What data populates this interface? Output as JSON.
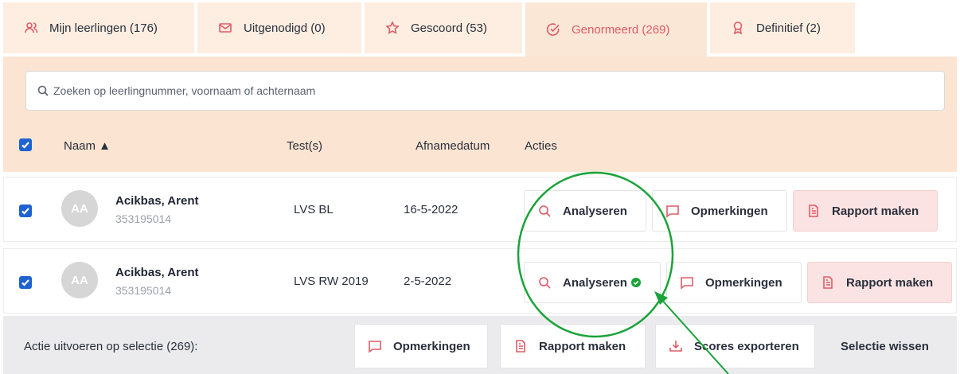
{
  "tabs": [
    {
      "label": "Mijn leerlingen (176)",
      "icon": "users-icon"
    },
    {
      "label": "Uitgenodigd (0)",
      "icon": "mail-icon"
    },
    {
      "label": "Gescoord (53)",
      "icon": "star-icon"
    },
    {
      "label": "Genormeerd (269)",
      "icon": "check-circle-icon"
    },
    {
      "label": "Definitief (2)",
      "icon": "award-icon"
    }
  ],
  "search": {
    "placeholder": "Zoeken op leerlingnummer, voornaam of achternaam"
  },
  "table": {
    "headers": {
      "name": "Naam ▲",
      "tests": "Test(s)",
      "date": "Afnamedatum",
      "actions": "Acties"
    },
    "rows": [
      {
        "initials": "AA",
        "name": "Acikbas, Arent",
        "number": "353195014",
        "test": "LVS BL",
        "date": "16-5-2022",
        "analyse": "Analyseren",
        "remarks": "Opmerkingen",
        "report": "Rapport maken",
        "analysed": false
      },
      {
        "initials": "AA",
        "name": "Acikbas, Arent",
        "number": "353195014",
        "test": "LVS RW 2019",
        "date": "2-5-2022",
        "analyse": "Analyseren",
        "remarks": "Opmerkingen",
        "report": "Rapport maken",
        "analysed": true
      }
    ]
  },
  "footer": {
    "label": "Actie uitvoeren op selectie (269):",
    "remarks": "Opmerkingen",
    "report": "Rapport maken",
    "export": "Scores exporteren",
    "clear": "Selectie wissen"
  },
  "colors": {
    "accent": "#e05b66",
    "panel": "#fbe5d2",
    "checkbox": "#1e63d0",
    "annotation": "#1aa33a",
    "success": "#1aa33a"
  }
}
